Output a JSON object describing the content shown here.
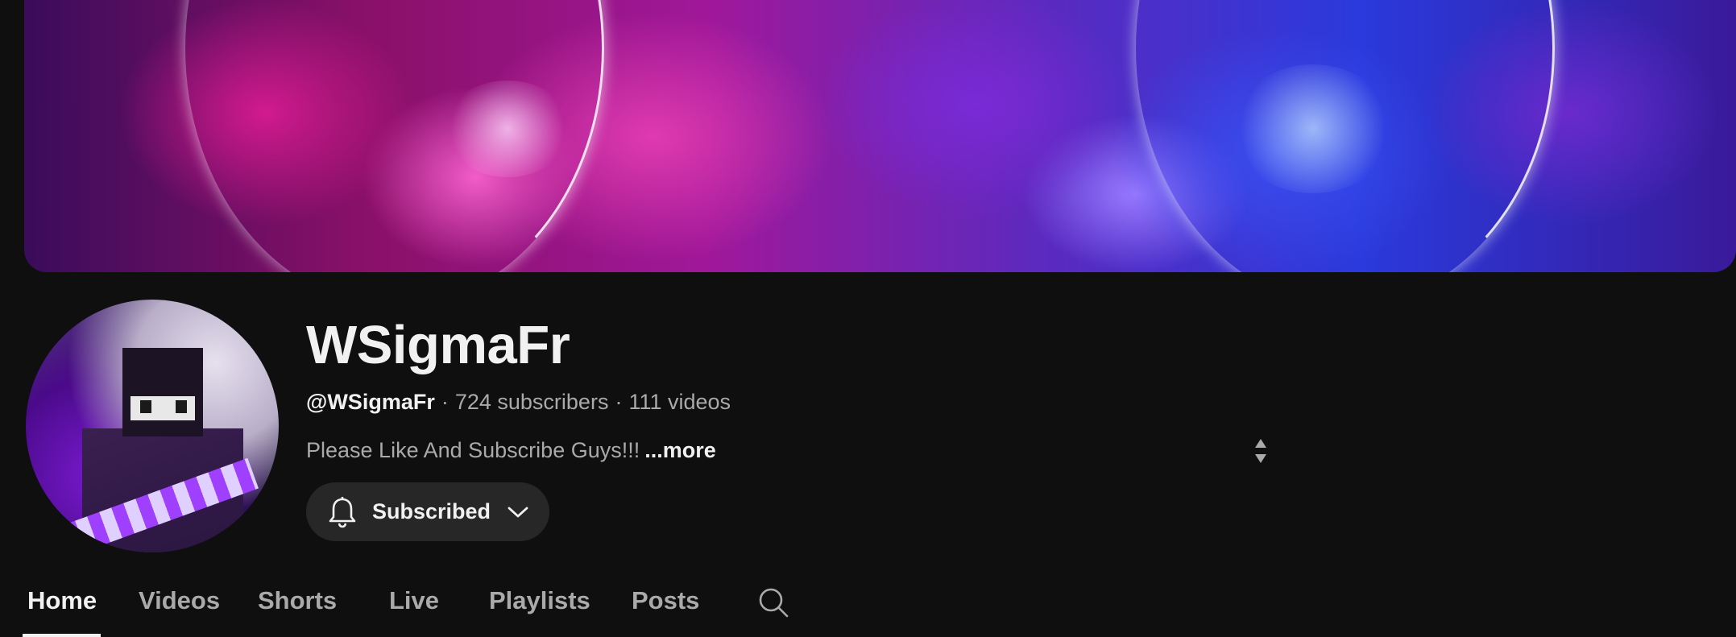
{
  "channel": {
    "name": "WSigmaFr",
    "handle": "@WSigmaFr",
    "subscribers": "724 subscribers",
    "videos": "111 videos",
    "separator": "·",
    "description": "Please Like And Subscribe Guys!!!",
    "more_label": "...more"
  },
  "subscribe": {
    "label": "Subscribed",
    "icon": "bell-icon"
  },
  "tabs": [
    {
      "label": "Home",
      "active": true
    },
    {
      "label": "Videos",
      "active": false
    },
    {
      "label": "Shorts",
      "active": false
    },
    {
      "label": "Live",
      "active": false
    },
    {
      "label": "Playlists",
      "active": false
    },
    {
      "label": "Posts",
      "active": false
    }
  ],
  "colors": {
    "background": "#0f0f0f",
    "text_primary": "#f1f1f1",
    "text_secondary": "#aaaaaa",
    "button_bg": "#272727"
  }
}
